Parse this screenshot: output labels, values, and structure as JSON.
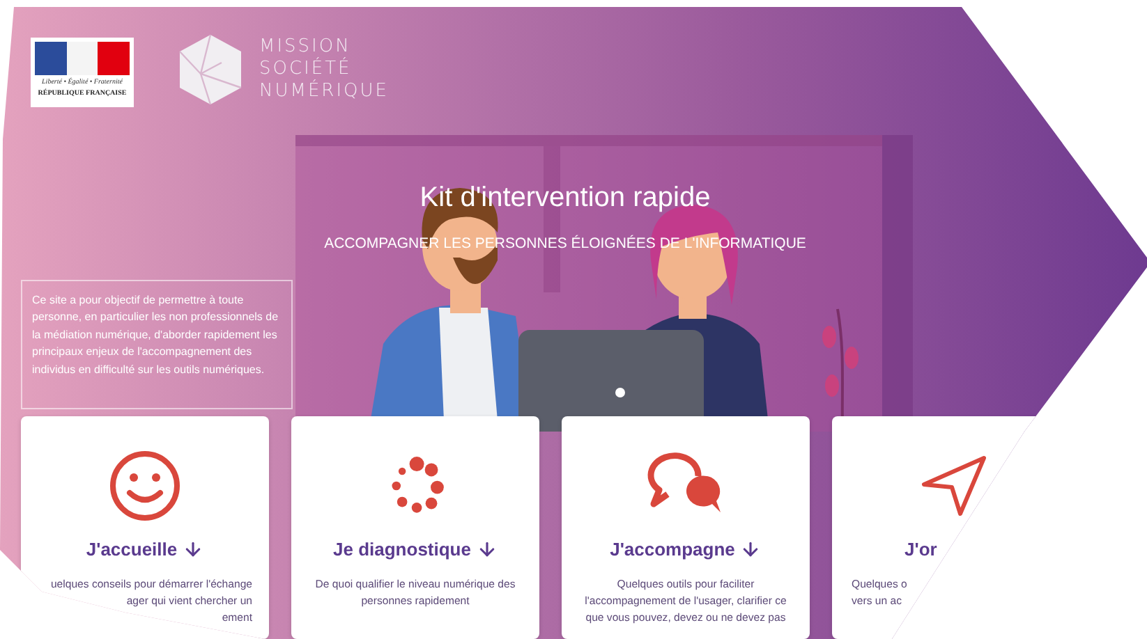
{
  "header": {
    "republic_logo": {
      "motto": "Liberté • Égalité • Fraternité",
      "name": "RÉPUBLIQUE FRANÇAISE"
    },
    "mission_logo": {
      "lines": [
        "MISSION",
        "SOCIÉTÉ",
        "NUMÉRIQUE"
      ]
    }
  },
  "hero": {
    "title": "Kit d'intervention rapide",
    "subtitle": "ACCOMPAGNER LES PERSONNES ÉLOIGNÉES DE L'INFORMATIQUE"
  },
  "intro": "Ce site a pour objectif de permettre à toute personne, en particulier les non professionnels de la médiation numérique, d'aborder rapidement les principaux enjeux de l'accompagnement des individus en difficulté sur les outils numériques.",
  "cards": [
    {
      "kind": "smiley",
      "title": "J'accueille",
      "lines": [
        "uelques conseils pour démarrer l'échange",
        "ager qui vient chercher un",
        "ement"
      ]
    },
    {
      "kind": "dots",
      "title": "Je diagnostique",
      "lines": [
        "De quoi qualifier le niveau numérique des",
        "personnes rapidement"
      ]
    },
    {
      "kind": "bubbles",
      "title": "J'accompagne",
      "lines": [
        "Quelques outils pour faciliter",
        "l'accompagnement de l'usager, clarifier ce",
        "que vous pouvez, devez ou ne devez pas"
      ]
    },
    {
      "kind": "plane",
      "title": "J'or",
      "lines": [
        "Quelques o",
        "vers un ac"
      ]
    }
  ]
}
